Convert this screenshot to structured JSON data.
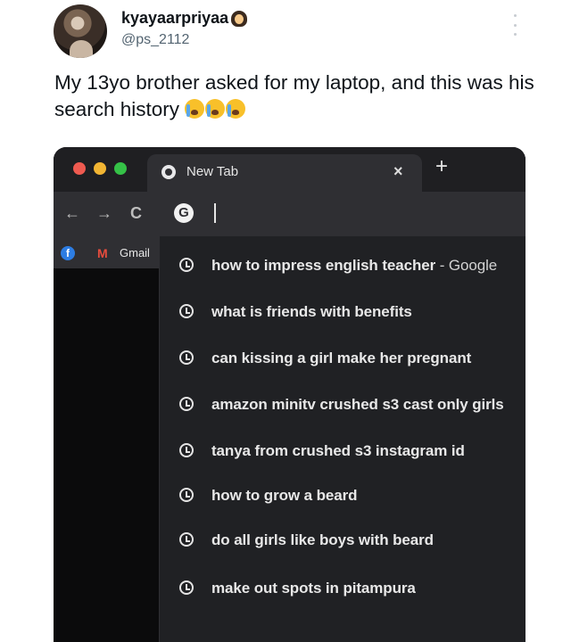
{
  "tweet": {
    "display_name": "kyayaarpriyaa",
    "name_emoji": "woman-emoji",
    "handle": "@ps_2112",
    "text": "My 13yo brother asked for my laptop, and this was his search history",
    "text_emoji": [
      "crying-face-emoji",
      "crying-face-emoji",
      "crying-face-emoji"
    ]
  },
  "browser": {
    "tab_title": "New Tab",
    "tab_close": "×",
    "new_tab": "+",
    "nav": {
      "back": "←",
      "forward": "→",
      "reload": "C"
    },
    "omnibox_icon": "G",
    "bookmarks": {
      "facebook_icon": "f",
      "gmail_icon": "M",
      "gmail_label": "Gmail"
    },
    "suggestions": [
      {
        "text": "how to impress english teacher",
        "suffix": " - Google"
      },
      {
        "text": "what is friends with benefits",
        "suffix": ""
      },
      {
        "text": "can kissing a girl make her pregnant",
        "suffix": ""
      },
      {
        "text": "amazon minitv crushed s3 cast only girls",
        "suffix": ""
      },
      {
        "text": "tanya from crushed s3 instagram id",
        "suffix": ""
      },
      {
        "text": "how to grow a beard",
        "suffix": ""
      },
      {
        "text": "do all girls like boys with beard",
        "suffix": ""
      },
      {
        "text": "make out spots in pitampura",
        "suffix": ""
      }
    ]
  },
  "colors": {
    "text": "#0f1419",
    "muted": "#536471",
    "browser_bg": "#0b0b0c",
    "dropdown_bg": "#202124",
    "accent_red": "#ee5a50",
    "accent_yellow": "#f2b533",
    "accent_green": "#35c147"
  }
}
